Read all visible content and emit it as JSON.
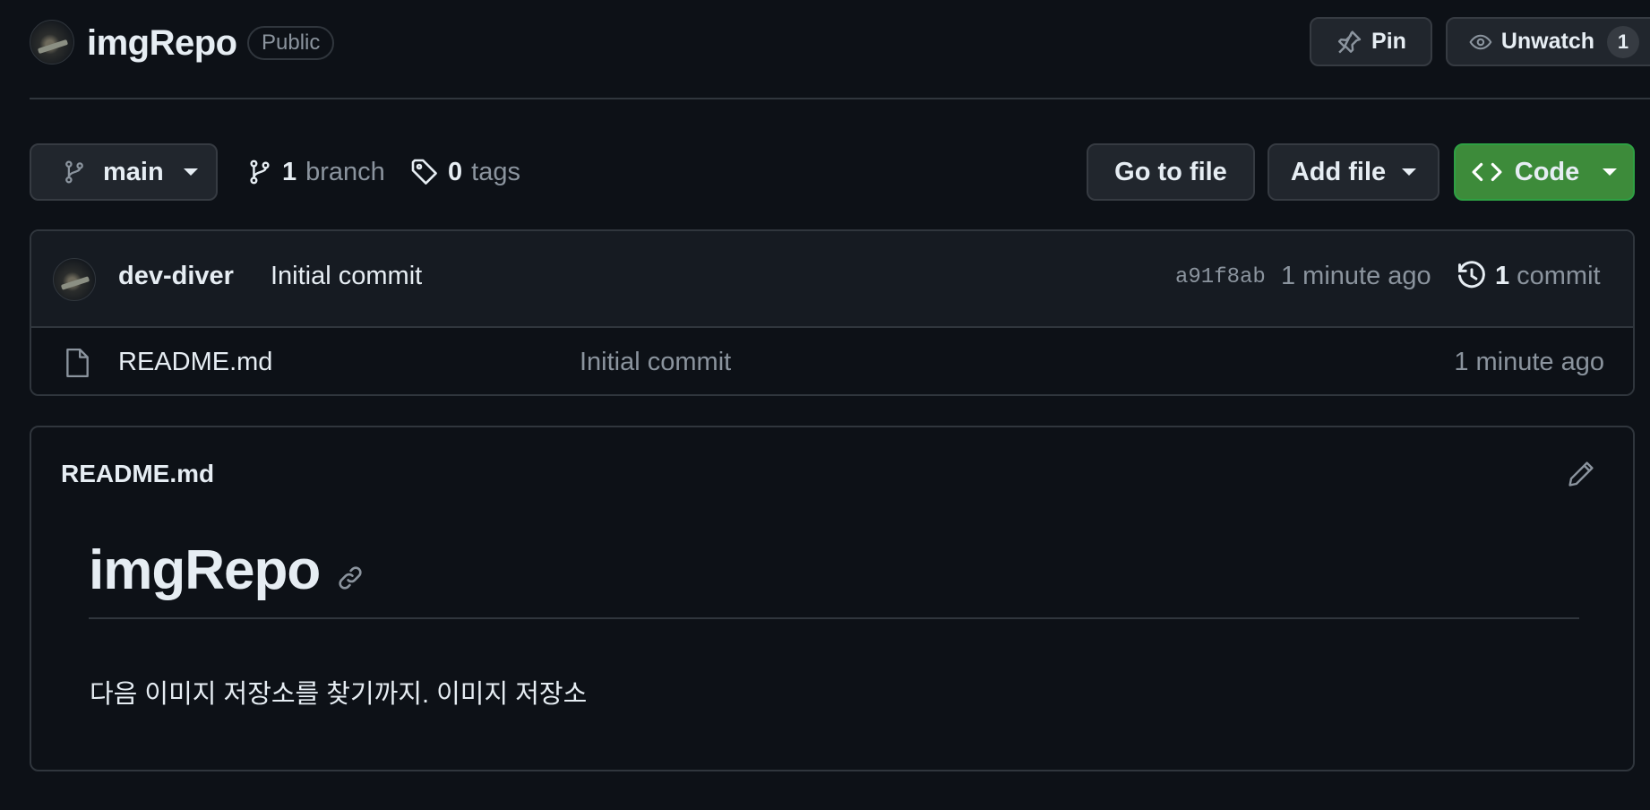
{
  "repo": {
    "name": "imgRepo",
    "visibility": "Public",
    "pin_label": "Pin",
    "watch_label": "Unwatch",
    "watch_count": "1"
  },
  "toolbar": {
    "branch": "main",
    "branch_count": "1",
    "branch_label": "branch",
    "tag_count": "0",
    "tag_label": "tags",
    "goto_file": "Go to file",
    "add_file": "Add file",
    "code": "Code"
  },
  "latest_commit": {
    "author": "dev-diver",
    "message": "Initial commit",
    "sha": "a91f8ab",
    "time": "1 minute ago",
    "count": "1",
    "count_label": "commit"
  },
  "files": [
    {
      "name": "README.md",
      "commit_message": "Initial commit",
      "time": "1 minute ago",
      "icon": "file-icon"
    }
  ],
  "readme": {
    "filename": "README.md",
    "heading": "imgRepo",
    "paragraph": "다음 이미지 저장소를 찾기까지. 이미지 저장소"
  },
  "colors": {
    "background": "#0d1117",
    "border": "#30363d",
    "button_bg": "#21262d",
    "code_button": "#3d8b3a",
    "muted_text": "#8b949e",
    "text": "#e6edf3"
  }
}
